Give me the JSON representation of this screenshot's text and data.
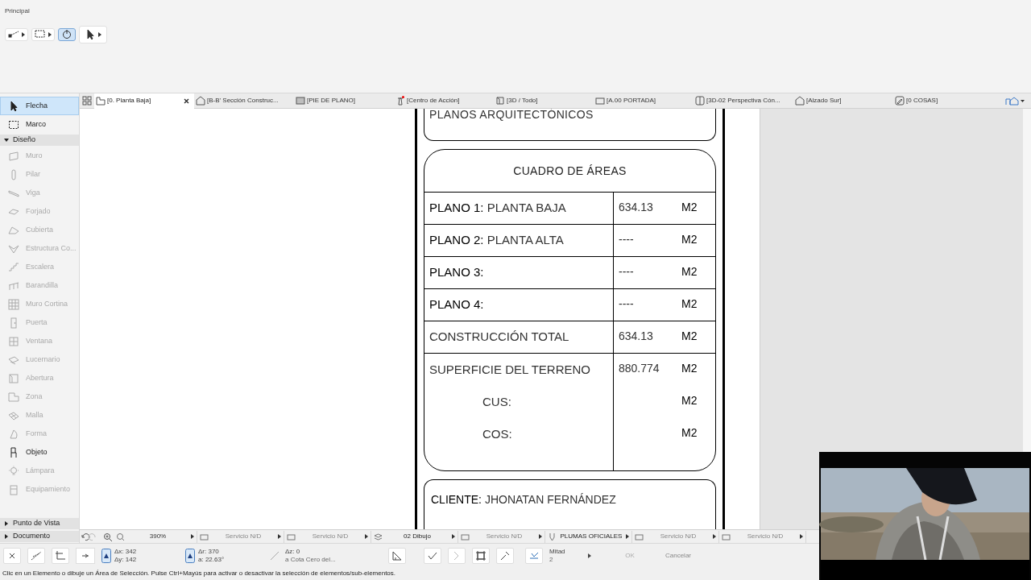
{
  "ribbon": {
    "label": "Principal",
    "tools": [
      {
        "selected": false
      },
      {
        "selected": false
      },
      {
        "selected": true
      },
      {
        "selected": false
      }
    ]
  },
  "tabs": [
    {
      "label": "[0. Planta Baja]",
      "selected": true
    },
    {
      "label": "[B-B' Sección Construc...",
      "selected": false
    },
    {
      "label": "[PIE DE PLANO]",
      "selected": false
    },
    {
      "label": "[Centro de Acción]",
      "selected": false
    },
    {
      "label": "[3D / Todo]",
      "selected": false
    },
    {
      "label": "[A.00 PORTADA]",
      "selected": false
    },
    {
      "label": "[3D-02 Perspectiva Cón...",
      "selected": false
    },
    {
      "label": "[Alzado Sur]",
      "selected": false
    },
    {
      "label": "[0 COSAS]",
      "selected": false
    }
  ],
  "toolbox": {
    "top_items": [
      {
        "label": "Flecha",
        "selected": true,
        "disabled": false
      },
      {
        "label": "Marco",
        "selected": false,
        "disabled": false
      }
    ],
    "sections": [
      {
        "label": "Diseño",
        "expanded": true,
        "items": [
          {
            "label": "Muro",
            "selected": false,
            "disabled": true
          },
          {
            "label": "Pilar",
            "selected": false,
            "disabled": true
          },
          {
            "label": "Viga",
            "selected": false,
            "disabled": true
          },
          {
            "label": "Forjado",
            "selected": false,
            "disabled": true
          },
          {
            "label": "Cubierta",
            "selected": false,
            "disabled": true
          },
          {
            "label": "Estructura Co...",
            "selected": false,
            "disabled": true
          },
          {
            "label": "Escalera",
            "selected": false,
            "disabled": true
          },
          {
            "label": "Barandilla",
            "selected": false,
            "disabled": true
          },
          {
            "label": "Muro Cortina",
            "selected": false,
            "disabled": true
          },
          {
            "label": "Puerta",
            "selected": false,
            "disabled": true
          },
          {
            "label": "Ventana",
            "selected": false,
            "disabled": true
          },
          {
            "label": "Lucernario",
            "selected": false,
            "disabled": true
          },
          {
            "label": "Abertura",
            "selected": false,
            "disabled": true
          },
          {
            "label": "Zona",
            "selected": false,
            "disabled": true
          },
          {
            "label": "Malla",
            "selected": false,
            "disabled": true
          },
          {
            "label": "Forma",
            "selected": false,
            "disabled": true
          },
          {
            "label": "Objeto",
            "selected": false,
            "disabled": false
          },
          {
            "label": "Lámpara",
            "selected": false,
            "disabled": true
          },
          {
            "label": "Equipamiento",
            "selected": false,
            "disabled": true
          }
        ]
      },
      {
        "label": "Punto de Vista",
        "expanded": false
      },
      {
        "label": "Documento",
        "expanded": false
      }
    ]
  },
  "sheet": {
    "header": "PLANOS ARQUITECTÓNICOS",
    "table_title": "CUADRO DE ÁREAS",
    "rows": [
      {
        "kind": "area",
        "label": "**PLANO 1:** PLANTA BAJA",
        "value": "634.13",
        "unit": "M2"
      },
      {
        "kind": "area",
        "label": "**PLANO 2:** PLANTA ALTA",
        "value": "----",
        "unit": "M2"
      },
      {
        "kind": "area",
        "label": "**PLANO 3:**",
        "value": "----",
        "unit": "M2"
      },
      {
        "kind": "area",
        "label": "**PLANO 4:**",
        "value": "----",
        "unit": "M2"
      },
      {
        "kind": "area",
        "label": "CONSTRUCCIÓN TOTAL",
        "value": "634.13",
        "unit": "M2"
      },
      {
        "kind": "area",
        "label": "SUPERFICIE DEL TERRENO",
        "value": "880.774",
        "unit": "M2"
      },
      {
        "kind": "ratio",
        "label": "CUS:",
        "unit": "M2"
      },
      {
        "kind": "ratio",
        "label": "COS:",
        "unit": "M2"
      }
    ],
    "client": "**CLIENTE:** JHONATAN FERNÁNDEZ"
  },
  "info_bar": [
    {
      "kind": "zoom",
      "text": "390%"
    },
    {
      "kind": "field",
      "text": "Servicio N/D"
    },
    {
      "kind": "field",
      "text": "Servicio N/D"
    },
    {
      "kind": "layer",
      "text": "02 Dibujo"
    },
    {
      "kind": "field",
      "text": "Servicio N/D"
    },
    {
      "kind": "pen",
      "text": "PLUMAS OFICIALES"
    },
    {
      "kind": "field",
      "text": "Servicio N/D"
    },
    {
      "kind": "field",
      "text": "Servicio N/D"
    }
  ],
  "coords": {
    "dx": "Δx: 342",
    "dy": "Δy: 142",
    "dr": "Δr: 370",
    "angle": "a: 22.63°",
    "dz": "Δz: 0",
    "ref": "a Cota Cero del...",
    "snap": "Mitad",
    "snap_value": "2",
    "ok": "OK",
    "cancel": "Cancelar",
    "ok_disabled": true
  },
  "status_bar": "Clic en un Elemento o dibuje un Área de Selección. Pulse Ctrl+Mayús para activar o desactivar la selección de elementos/sub-elementos."
}
